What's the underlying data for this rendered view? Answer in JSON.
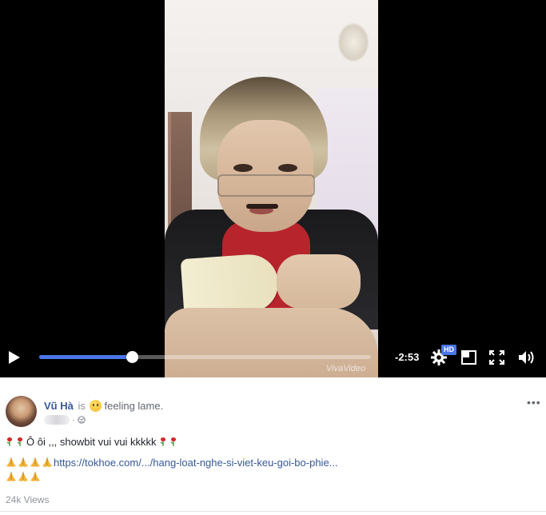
{
  "video": {
    "watermark": "VivaVideo",
    "time_remaining": "-2:53",
    "hd_badge": "HD",
    "progress": 0.28,
    "icons": {
      "play": "play-icon",
      "settings": "gear-icon",
      "fullscreen_small": "picture-in-picture-icon",
      "fullscreen": "fullscreen-icon",
      "volume": "volume-icon"
    }
  },
  "post": {
    "author": "Vũ Hà",
    "is_word": "is",
    "feeling": "feeling lame.",
    "line1_text": "Ô ôi ,,, showbit vui vui kkkkk",
    "link_text": "https://tokhoe.com/.../hang-loat-nghe-si-viet-keu-goi-bo-phie...",
    "views": "24k Views",
    "more": "•••"
  },
  "colors": {
    "accent": "#4a76e8",
    "link": "#365899",
    "muted": "#90949c"
  }
}
